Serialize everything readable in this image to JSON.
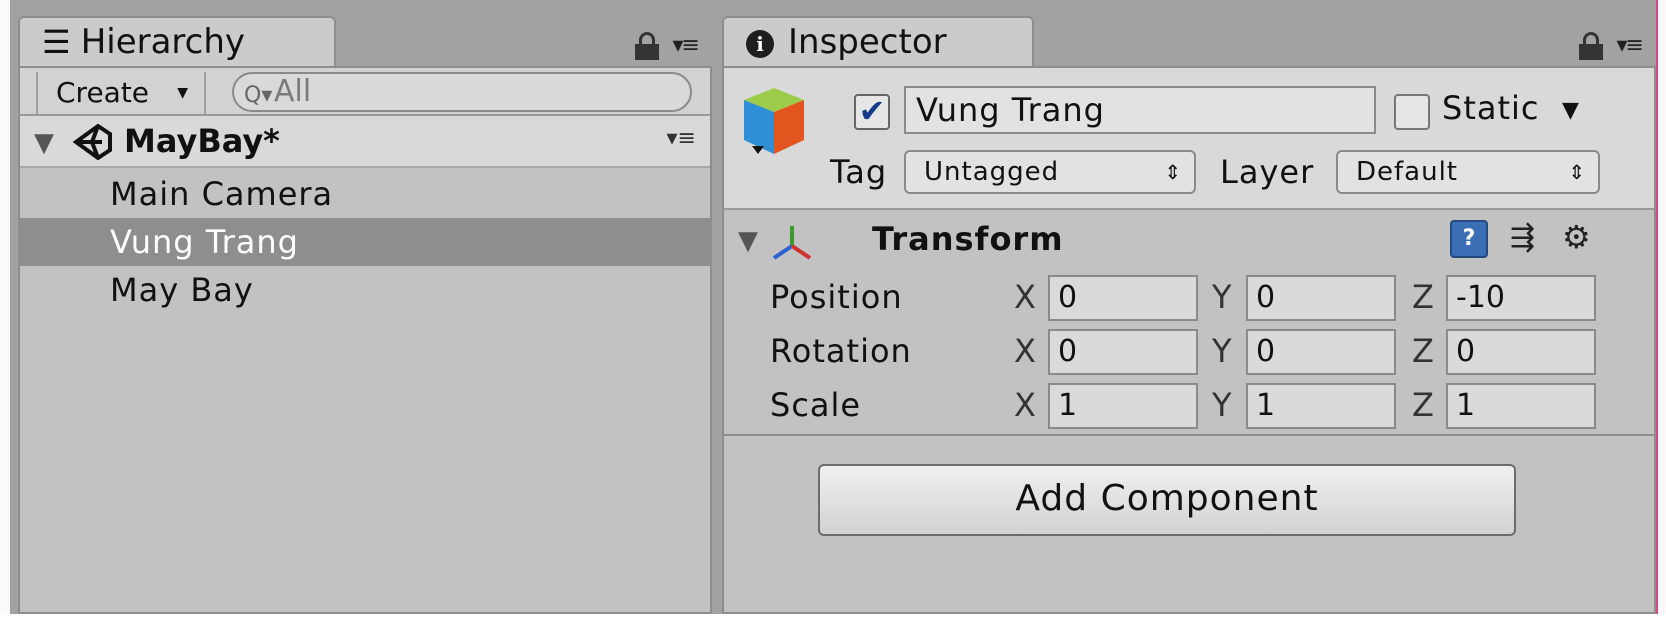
{
  "hierarchy": {
    "tab_label": "Hierarchy",
    "tab_icon": "list-icon",
    "create_label": "Create",
    "search_placeholder": "All",
    "scene": {
      "name": "MayBay*"
    },
    "items": [
      {
        "label": "Main Camera",
        "selected": false
      },
      {
        "label": "Vung Trang",
        "selected": true
      },
      {
        "label": "May Bay",
        "selected": false
      }
    ]
  },
  "inspector": {
    "tab_label": "Inspector",
    "tab_icon": "info-icon",
    "object": {
      "active": true,
      "name": "Vung Trang",
      "static_label": "Static",
      "static_checked": false,
      "tag_label": "Tag",
      "tag_value": "Untagged",
      "layer_label": "Layer",
      "layer_value": "Default"
    },
    "transform": {
      "title": "Transform",
      "rows": [
        {
          "label": "Position",
          "x": "0",
          "y": "0",
          "z": "-10"
        },
        {
          "label": "Rotation",
          "x": "0",
          "y": "0",
          "z": "0"
        },
        {
          "label": "Scale",
          "x": "1",
          "y": "1",
          "z": "1"
        }
      ],
      "axis_labels": {
        "x": "X",
        "y": "Y",
        "z": "Z"
      }
    },
    "add_component_label": "Add Component"
  },
  "colors": {
    "selected_row": "#8e8e8e",
    "panel_body": "#c2c2c2",
    "header_bg": "#d9d9d9",
    "accent_pink": "#d24a8e"
  }
}
